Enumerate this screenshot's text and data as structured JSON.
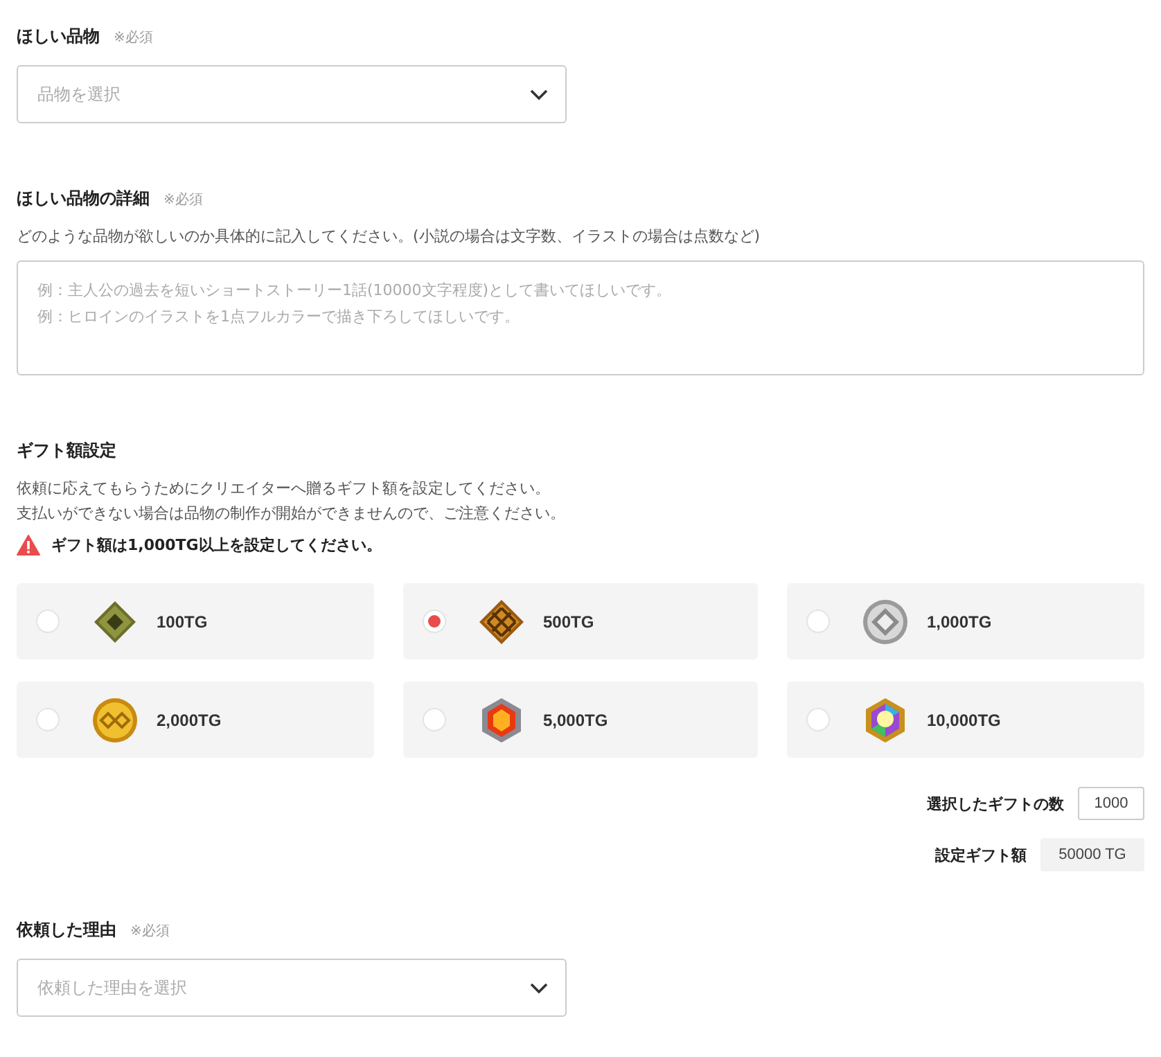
{
  "item": {
    "label": "ほしい品物",
    "required": "※必須",
    "placeholder": "品物を選択"
  },
  "detail": {
    "label": "ほしい品物の詳細",
    "required": "※必須",
    "description": "どのような品物が欲しいのか具体的に記入してください。(小説の場合は文字数、イラストの場合は点数など)",
    "placeholder": [
      "例：主人公の過去を短いショートストーリー1話(10000文字程度)として書いてほしいです。",
      "例：ヒロインのイラストを1点フルカラーで描き下ろしてほしいです。"
    ]
  },
  "gift": {
    "label": "ギフト額設定",
    "description": [
      "依頼に応えてもらうためにクリエイターへ贈るギフト額を設定してください。",
      "支払いができない場合は品物の制作が開始ができませんので、ご注意ください。"
    ],
    "warning": "ギフト額は1,000TG以上を設定してください。",
    "options": [
      {
        "label": "100TG",
        "kind": "olive",
        "selected": false
      },
      {
        "label": "500TG",
        "kind": "waffle",
        "selected": true
      },
      {
        "label": "1,000TG",
        "kind": "silver",
        "selected": false
      },
      {
        "label": "2,000TG",
        "kind": "gold",
        "selected": false
      },
      {
        "label": "5,000TG",
        "kind": "ruby",
        "selected": false
      },
      {
        "label": "10,000TG",
        "kind": "gem",
        "selected": false
      }
    ],
    "count_label": "選択したギフトの数",
    "count": "1000",
    "amount_label": "設定ギフト額",
    "amount": "50000 TG"
  },
  "reason": {
    "label": "依頼した理由",
    "required": "※必須",
    "placeholder": "依頼した理由を選択"
  }
}
